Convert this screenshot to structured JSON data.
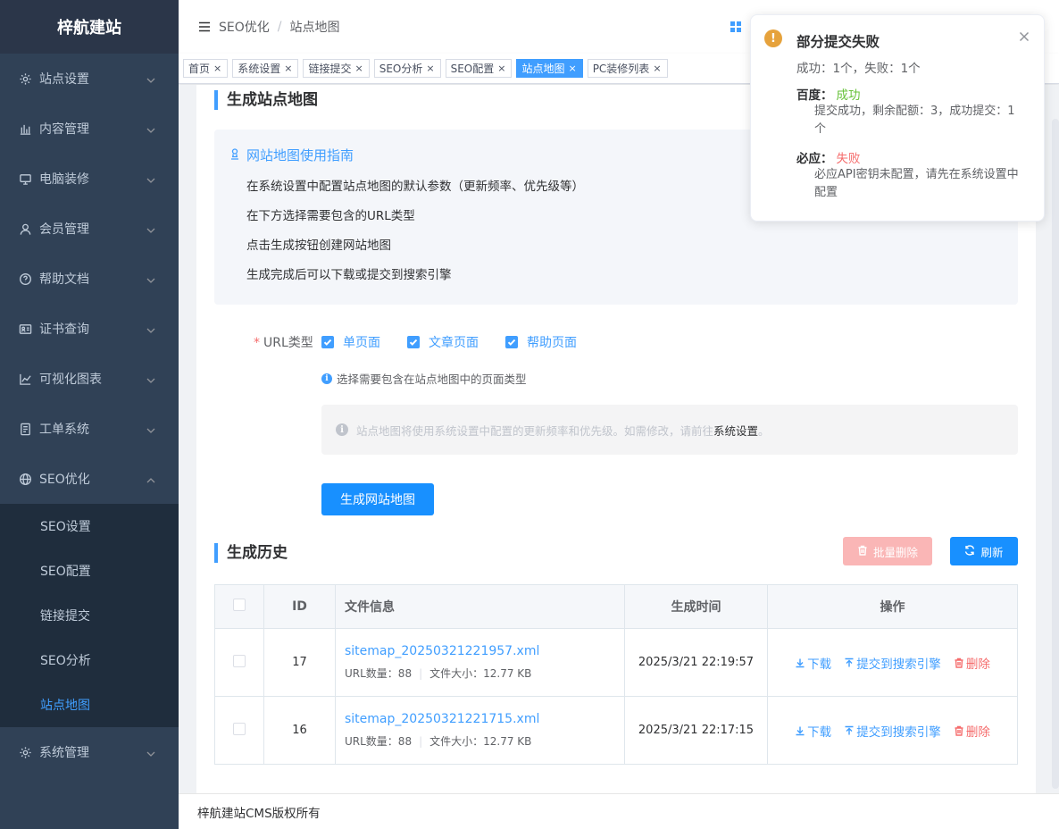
{
  "sidebar": {
    "logo": "梓航建站",
    "items": [
      {
        "label": "站点设置",
        "icon": "gear-icon"
      },
      {
        "label": "内容管理",
        "icon": "bar-chart-icon"
      },
      {
        "label": "电脑装修",
        "icon": "monitor-icon"
      },
      {
        "label": "会员管理",
        "icon": "user-icon"
      },
      {
        "label": "帮助文档",
        "icon": "help-icon"
      },
      {
        "label": "证书查询",
        "icon": "id-card-icon"
      },
      {
        "label": "可视化图表",
        "icon": "line-chart-icon"
      },
      {
        "label": "工单系统",
        "icon": "document-icon"
      },
      {
        "label": "SEO优化",
        "icon": "globe-icon"
      }
    ],
    "seo_sub": [
      {
        "label": "SEO设置"
      },
      {
        "label": "SEO配置"
      },
      {
        "label": "链接提交"
      },
      {
        "label": "SEO分析"
      },
      {
        "label": "站点地图"
      }
    ],
    "system": {
      "label": "系统管理",
      "icon": "gear-icon"
    }
  },
  "header": {
    "breadcrumb": [
      "SEO优化",
      "站点地图"
    ]
  },
  "tags": [
    {
      "label": "首页"
    },
    {
      "label": "系统设置"
    },
    {
      "label": "链接提交"
    },
    {
      "label": "SEO分析"
    },
    {
      "label": "SEO配置"
    },
    {
      "label": "站点地图"
    },
    {
      "label": "PC装修列表"
    }
  ],
  "generate": {
    "title": "生成站点地图",
    "guide_title": "网站地图使用指南",
    "guide_lines": [
      "在系统设置中配置站点地图的默认参数（更新频率、优先级等）",
      "在下方选择需要包含的URL类型",
      "点击生成按钮创建网站地图",
      "生成完成后可以下载或提交到搜索引擎"
    ],
    "url_label": "URL类型",
    "url_types": [
      "单页面",
      "文章页面",
      "帮助页面"
    ],
    "hint": "选择需要包含在站点地图中的页面类型",
    "notice_text": "站点地图将使用系统设置中配置的更新频率和优先级。如需修改，请前往",
    "notice_link": "系统设置",
    "notice_end": "。",
    "button": "生成网站地图"
  },
  "history": {
    "title": "生成历史",
    "batch_delete": "批量删除",
    "refresh": "刷新",
    "columns": [
      "ID",
      "文件信息",
      "生成时间",
      "操作"
    ],
    "rows": [
      {
        "id": "17",
        "file": "sitemap_20250321221957.xml",
        "url_count": "URL数量：88",
        "file_size": "文件大小：12.77 KB",
        "time": "2025/3/21 22:19:57"
      },
      {
        "id": "16",
        "file": "sitemap_20250321221715.xml",
        "url_count": "URL数量：88",
        "file_size": "文件大小：12.77 KB",
        "time": "2025/3/21 22:17:15"
      }
    ],
    "ops": {
      "download": "下载",
      "submit": "提交到搜索引擎",
      "delete": "删除"
    }
  },
  "footer": {
    "text": "梓航建站CMS版权所有"
  },
  "notification": {
    "title": "部分提交失败",
    "summary": "成功：1个，失败：1个",
    "engines": [
      {
        "name": "百度：",
        "status": "成功",
        "message": "提交成功，剩余配额：3，成功提交：1个"
      },
      {
        "name": "必应：",
        "status": "失败",
        "message": "必应API密钥未配置，请先在系统设置中配置"
      }
    ]
  },
  "colors": {
    "primary": "#409eff",
    "sidebar": "#304156",
    "success": "#67c23a",
    "danger": "#f56c6c",
    "warning": "#e6a23c"
  }
}
